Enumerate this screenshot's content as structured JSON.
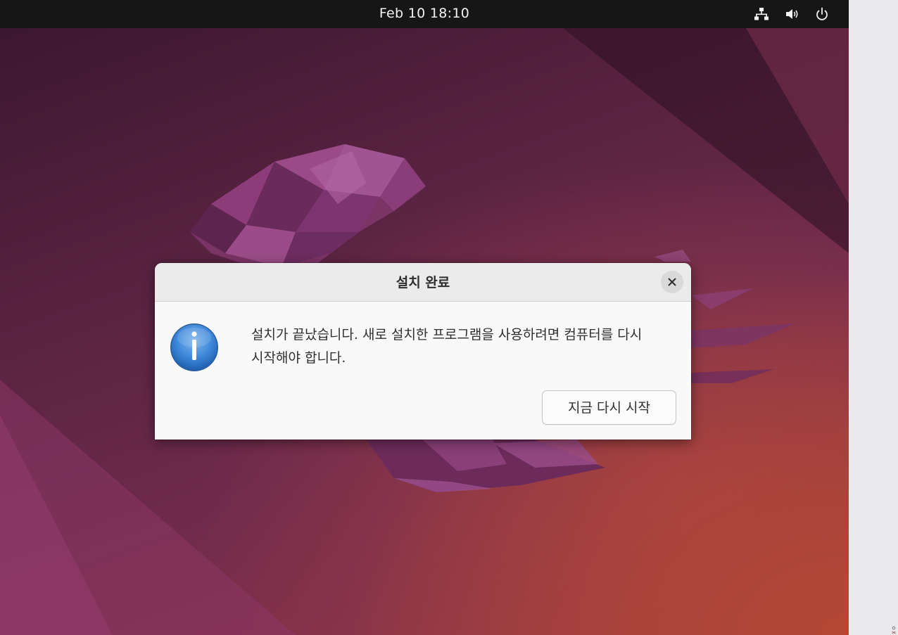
{
  "topbar": {
    "clock": "Feb 10  18:10",
    "tray_icons": [
      "network-icon",
      "volume-icon",
      "power-icon"
    ]
  },
  "dialog": {
    "title": "설치 완료",
    "close_icon": "close-icon",
    "info_icon": "info-icon",
    "message": "설치가 끝났습니다. 새로 설치한 프로그램을 사용하려면 컴퓨터를 다시 시작해야 합니다.",
    "restart_button": "지금 다시 시작"
  },
  "colors": {
    "topbar": "#161616",
    "wallpaper_dark": "#3c1731",
    "wallpaper_warm": "#b94a32",
    "dialog_bg": "#f9f9f9",
    "info_blue": "#3d87d8"
  }
}
